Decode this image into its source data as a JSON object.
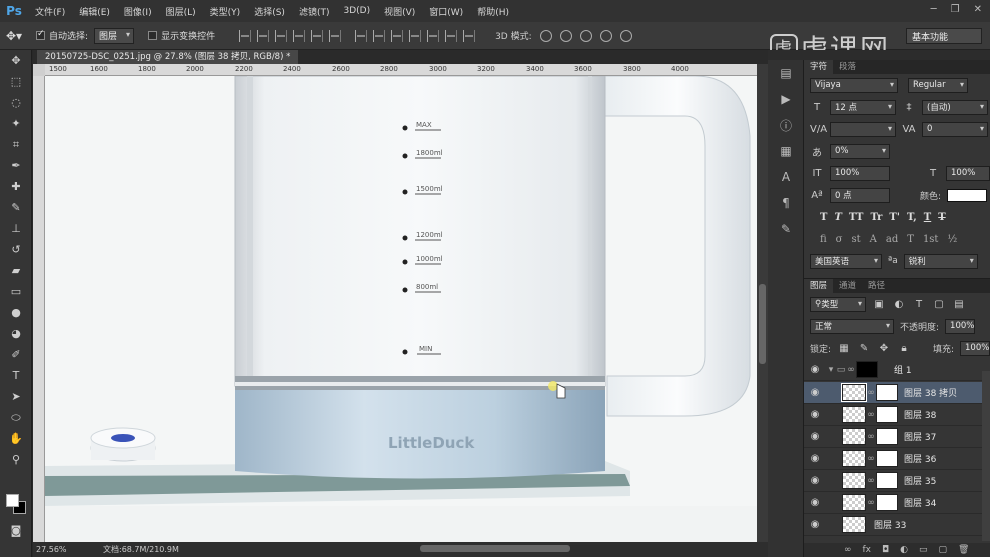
{
  "app": {
    "logo": "Ps",
    "menu": [
      "文件(F)",
      "编辑(E)",
      "图像(I)",
      "图层(L)",
      "类型(Y)",
      "选择(S)",
      "滤镜(T)",
      "3D(D)",
      "视图(V)",
      "窗口(W)",
      "帮助(H)"
    ]
  },
  "options_bar": {
    "auto_select_label": "自动选择:",
    "auto_select_value": "图层",
    "show_transform_label": "显示变换控件",
    "mode3d_label": "3D 模式:",
    "workspace": "基本功能"
  },
  "watermark": {
    "text": "虎课网",
    "icon": "tiger-logo-icon"
  },
  "document": {
    "tab_title": "20150725-DSC_0251.jpg @ 27.8% (图层 38 拷贝, RGB/8) *",
    "ruler_ticks": [
      "1500",
      "1600",
      "1800",
      "2000",
      "2200",
      "2400",
      "2600",
      "2800",
      "3000",
      "3200",
      "3400",
      "3600",
      "3800",
      "4000"
    ],
    "zoom": "27.56%",
    "doc_size": "文档:68.7M/210.9M",
    "kettle": {
      "markings": [
        "MAX",
        "1800ml",
        "1500ml",
        "1200ml",
        "1000ml",
        "800ml",
        "MIN"
      ],
      "brand": "LittleDuck"
    }
  },
  "character_panel": {
    "tabs": [
      "字符",
      "段落"
    ],
    "font_family": "Vijaya",
    "font_style": "Regular",
    "font_size": "12 点",
    "leading": "(自动)",
    "kerning": "",
    "tracking": "0",
    "tsume": "0%",
    "vertical_scale": "100%",
    "horizontal_scale": "100%",
    "baseline_shift": "0 点",
    "color_label": "颜色:",
    "color": "#ffffff",
    "typo_buttons": [
      "T",
      "T",
      "TT",
      "Tr",
      "T'",
      "T,",
      "T",
      "T"
    ],
    "ot_buttons": [
      "fi",
      "σ",
      "st",
      "A",
      "ad",
      "T",
      "1st",
      "½"
    ],
    "language": "美国英语",
    "aa_label": "a",
    "antialias": "锐利"
  },
  "layers_panel": {
    "tabs": [
      "图层",
      "通道",
      "路径"
    ],
    "filter": "类型",
    "blend_mode": "正常",
    "opacity_label": "不透明度:",
    "opacity": "100%",
    "lock_label": "锁定:",
    "fill_label": "填充:",
    "fill": "100%",
    "group_name": "组 1",
    "layers": [
      {
        "name": "图层 38 拷贝",
        "selected": true,
        "mask": true
      },
      {
        "name": "图层 38",
        "selected": false,
        "mask": true
      },
      {
        "name": "图层 37",
        "selected": false,
        "mask": true
      },
      {
        "name": "图层 36",
        "selected": false,
        "mask": true
      },
      {
        "name": "图层 35",
        "selected": false,
        "mask": true
      },
      {
        "name": "图层 34",
        "selected": false,
        "mask": true
      },
      {
        "name": "图层 33",
        "selected": false,
        "mask": false
      }
    ],
    "footer_icons": [
      "link-icon",
      "fx-icon",
      "mask-icon",
      "adjustment-icon",
      "folder-icon",
      "new-layer-icon",
      "trash-icon"
    ]
  }
}
